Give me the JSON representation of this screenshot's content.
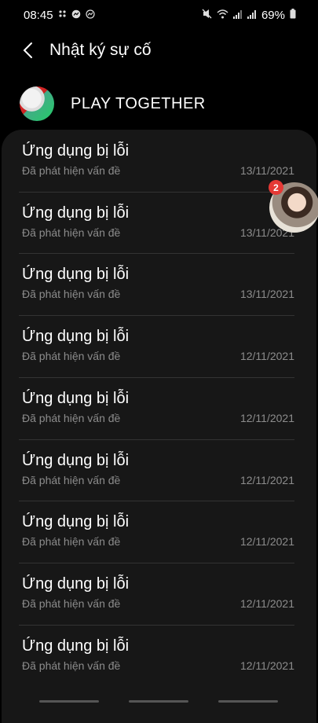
{
  "status_bar": {
    "time": "08:45",
    "battery": "69%",
    "icons_left": [
      "dots-icon",
      "messenger-icon",
      "messenger-icon"
    ],
    "icons_right": [
      "mute-icon",
      "wifi-icon",
      "signal-icon",
      "signal-icon",
      "battery-icon"
    ]
  },
  "header": {
    "title": "Nhật ký sự cố"
  },
  "app": {
    "name": "PLAY TOGETHER"
  },
  "chat_bubble": {
    "badge_count": "2"
  },
  "incidents": [
    {
      "title": "Ứng dụng bị lỗi",
      "subtitle": "Đã phát hiện vấn đề",
      "date": "13/11/2021"
    },
    {
      "title": "Ứng dụng bị lỗi",
      "subtitle": "Đã phát hiện vấn đề",
      "date": "13/11/2021"
    },
    {
      "title": "Ứng dụng bị lỗi",
      "subtitle": "Đã phát hiện vấn đề",
      "date": "13/11/2021"
    },
    {
      "title": "Ứng dụng bị lỗi",
      "subtitle": "Đã phát hiện vấn đề",
      "date": "12/11/2021"
    },
    {
      "title": "Ứng dụng bị lỗi",
      "subtitle": "Đã phát hiện vấn đề",
      "date": "12/11/2021"
    },
    {
      "title": "Ứng dụng bị lỗi",
      "subtitle": "Đã phát hiện vấn đề",
      "date": "12/11/2021"
    },
    {
      "title": "Ứng dụng bị lỗi",
      "subtitle": "Đã phát hiện vấn đề",
      "date": "12/11/2021"
    },
    {
      "title": "Ứng dụng bị lỗi",
      "subtitle": "Đã phát hiện vấn đề",
      "date": "12/11/2021"
    },
    {
      "title": "Ứng dụng bị lỗi",
      "subtitle": "Đã phát hiện vấn đề",
      "date": "12/11/2021"
    }
  ]
}
